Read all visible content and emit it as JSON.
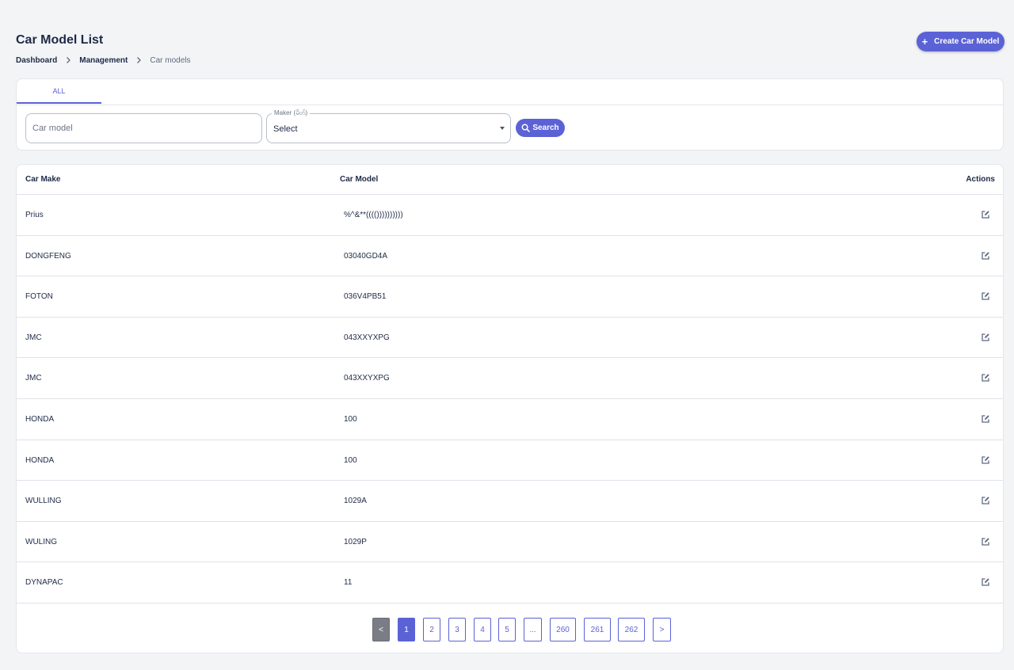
{
  "header": {
    "title": "Car Model List",
    "breadcrumb": [
      "Dashboard",
      "Management",
      "Car models"
    ],
    "create_button": "Create Car Model"
  },
  "filters": {
    "tabs": [
      "ALL"
    ],
    "car_model_input": {
      "placeholder": "Car model",
      "value": ""
    },
    "maker_select": {
      "legend": "Maker (မိတ်)",
      "value": "Select"
    },
    "search_button": "Search"
  },
  "table": {
    "headers": {
      "make": "Car Make",
      "model": "Car Model",
      "actions": "Actions"
    },
    "rows": [
      {
        "make": "Prius",
        "model": "%^&**(((())))))))))"
      },
      {
        "make": "DONGFENG",
        "model": "03040GD4A"
      },
      {
        "make": "FOTON",
        "model": "036V4PB51"
      },
      {
        "make": "JMC",
        "model": "043XXYXPG"
      },
      {
        "make": "JMC",
        "model": "043XXYXPG"
      },
      {
        "make": "HONDA",
        "model": "100"
      },
      {
        "make": "HONDA",
        "model": "100"
      },
      {
        "make": "WULLING",
        "model": "1029A"
      },
      {
        "make": "WULING",
        "model": "1029P"
      },
      {
        "make": "DYNAPAC",
        "model": "11"
      }
    ],
    "row_action_icon": "edit-icon"
  },
  "pagination": {
    "prev": "<",
    "pages": [
      "1",
      "2",
      "3",
      "4",
      "5",
      "...",
      "260",
      "261",
      "262"
    ],
    "next": ">",
    "current": "1"
  },
  "colors": {
    "accent": "#5b62d6",
    "background": "#f3f4f6",
    "text": "#1e2a46",
    "prev_button": "#7a7d85"
  }
}
